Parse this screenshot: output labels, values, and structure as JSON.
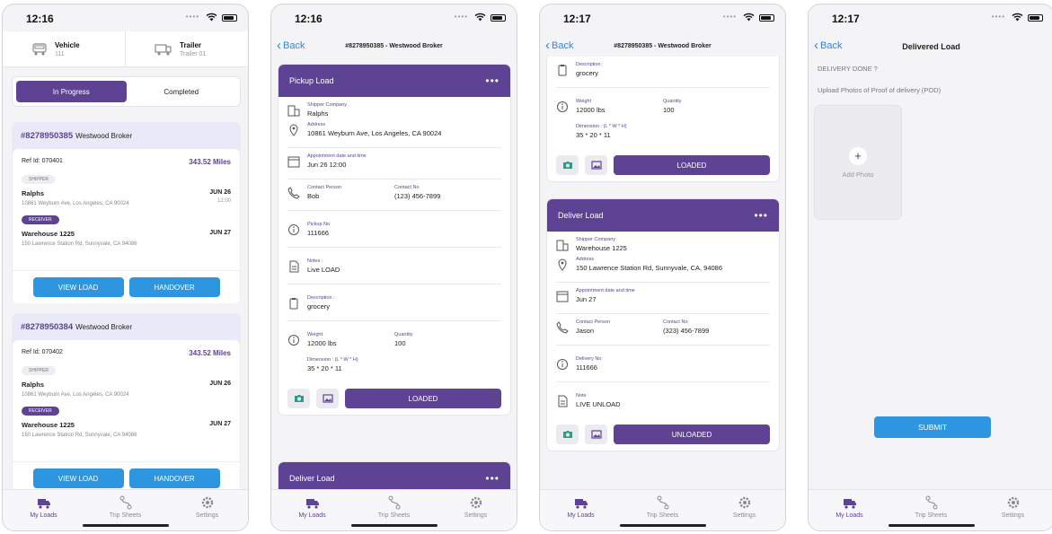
{
  "status": {
    "time1": "12:16",
    "time2": "12:16",
    "time3": "12:17",
    "time4": "12:17"
  },
  "tabs": [
    {
      "label": "My Loads",
      "icon": "truck-icon"
    },
    {
      "label": "Trip Sheets",
      "icon": "route-icon"
    },
    {
      "label": "Settings",
      "icon": "gear-icon"
    }
  ],
  "screen1": {
    "vehicle": {
      "label": "Vehicle",
      "value": "111"
    },
    "trailer": {
      "label": "Trailer",
      "value": "Trailer 01"
    },
    "segments": [
      "In Progress",
      "Completed"
    ],
    "loads": [
      {
        "id": "#8278950385",
        "broker": "Westwood Broker",
        "ref": "Ref Id: 070401",
        "miles": "343.52 Miles",
        "shipper_tag": "SHIPPER",
        "shipper_name": "Ralphs",
        "shipper_addr": "10861 Weyburn Ave, Los Angeles, CA 90024",
        "shipper_date": "JUN 26",
        "shipper_time": "12:00",
        "receiver_tag": "RECEIVER",
        "receiver_name": "Warehouse 1225",
        "receiver_addr": "150 Lawrence Station Rd, Sunnyvale, CA 94086",
        "receiver_date": "JUN 27",
        "view": "VIEW LOAD",
        "handover": "HANDOVER"
      },
      {
        "id": "#8278950384",
        "broker": "Westwood Broker",
        "ref": "Ref Id: 070402",
        "miles": "343.52 Miles",
        "shipper_tag": "SHIPPER",
        "shipper_name": "Ralphs",
        "shipper_addr": "10861 Weyburn Ave, Los Angeles, CA 90024",
        "shipper_date": "JUN 26",
        "shipper_time": "",
        "receiver_tag": "RECEIVER",
        "receiver_name": "Warehouse 1225",
        "receiver_addr": "150 Lawrence Station Rd, Sunnyvale, CA 94086",
        "receiver_date": "JUN 27",
        "view": "VIEW LOAD",
        "handover": "HANDOVER"
      }
    ]
  },
  "screen2": {
    "back": "Back",
    "title": "#8278950385 - Westwood Broker",
    "pickup": {
      "header": "Pickup Load",
      "more": "•••",
      "shipper_label": "Shipper Company",
      "shipper": "Ralphs",
      "address_label": "Address",
      "address": "10861 Weyburn Ave, Los Angeles, CA 90024",
      "appt_label": "Appointment date and time",
      "appt": "Jun 26 12:00",
      "contact_label": "Contact Person",
      "contact": "Bob",
      "contact_no_label": "Contact No",
      "contact_no": "(123) 456-7899",
      "pickup_no_label": "Pickup No",
      "pickup_no": "111666",
      "notes_label": "Notes :",
      "notes": "Live LOAD",
      "desc_label": "Description :",
      "desc": "grocery",
      "weight_label": "Weight",
      "weight": "12000 lbs",
      "qty_label": "Quantity",
      "qty": "100",
      "dim_label": "Dimension : (L * W * H)",
      "dim": "35 * 20 * 11",
      "action": "LOADED"
    },
    "deliver_header": "Deliver Load"
  },
  "screen3": {
    "back": "Back",
    "title": "#8278950385 - Westwood Broker",
    "top": {
      "desc_label": "Description :",
      "desc": "grocery",
      "weight_label": "Weight",
      "weight": "12000 lbs",
      "qty_label": "Quantity",
      "qty": "100",
      "dim_label": "Dimension : (L * W * H)",
      "dim": "35 * 20 * 11",
      "action": "LOADED"
    },
    "deliver": {
      "header": "Deliver Load",
      "more": "•••",
      "shipper_label": "Shipper Company",
      "shipper": "Warehouse 1225",
      "address_label": "Address",
      "address": "150 Lawrence Station Rd, Sunnyvale, CA, 94086",
      "appt_label": "Appointment date and time",
      "appt": "Jun 27",
      "contact_label": "Contact Person",
      "contact": "Jason",
      "contact_no_label": "Contact No",
      "contact_no": "(323) 456-7899",
      "delivery_no_label": "Delivery No",
      "delivery_no": "111666",
      "note_label": "Note",
      "note": "LIVE UNLOAD",
      "action": "UNLOADED"
    }
  },
  "screen4": {
    "back": "Back",
    "title": "Delivered Load",
    "question": "DELIVERY DONE ?",
    "upload": "Upload Photos of Proof of delivery (POD)",
    "plus": "+",
    "add_photo": "Add Photo",
    "submit": "SUBMIT"
  },
  "colors": {
    "purple": "#5e4394",
    "blue": "#2e95e0",
    "link": "#2e86e6",
    "teal": "#2d9b8a"
  }
}
